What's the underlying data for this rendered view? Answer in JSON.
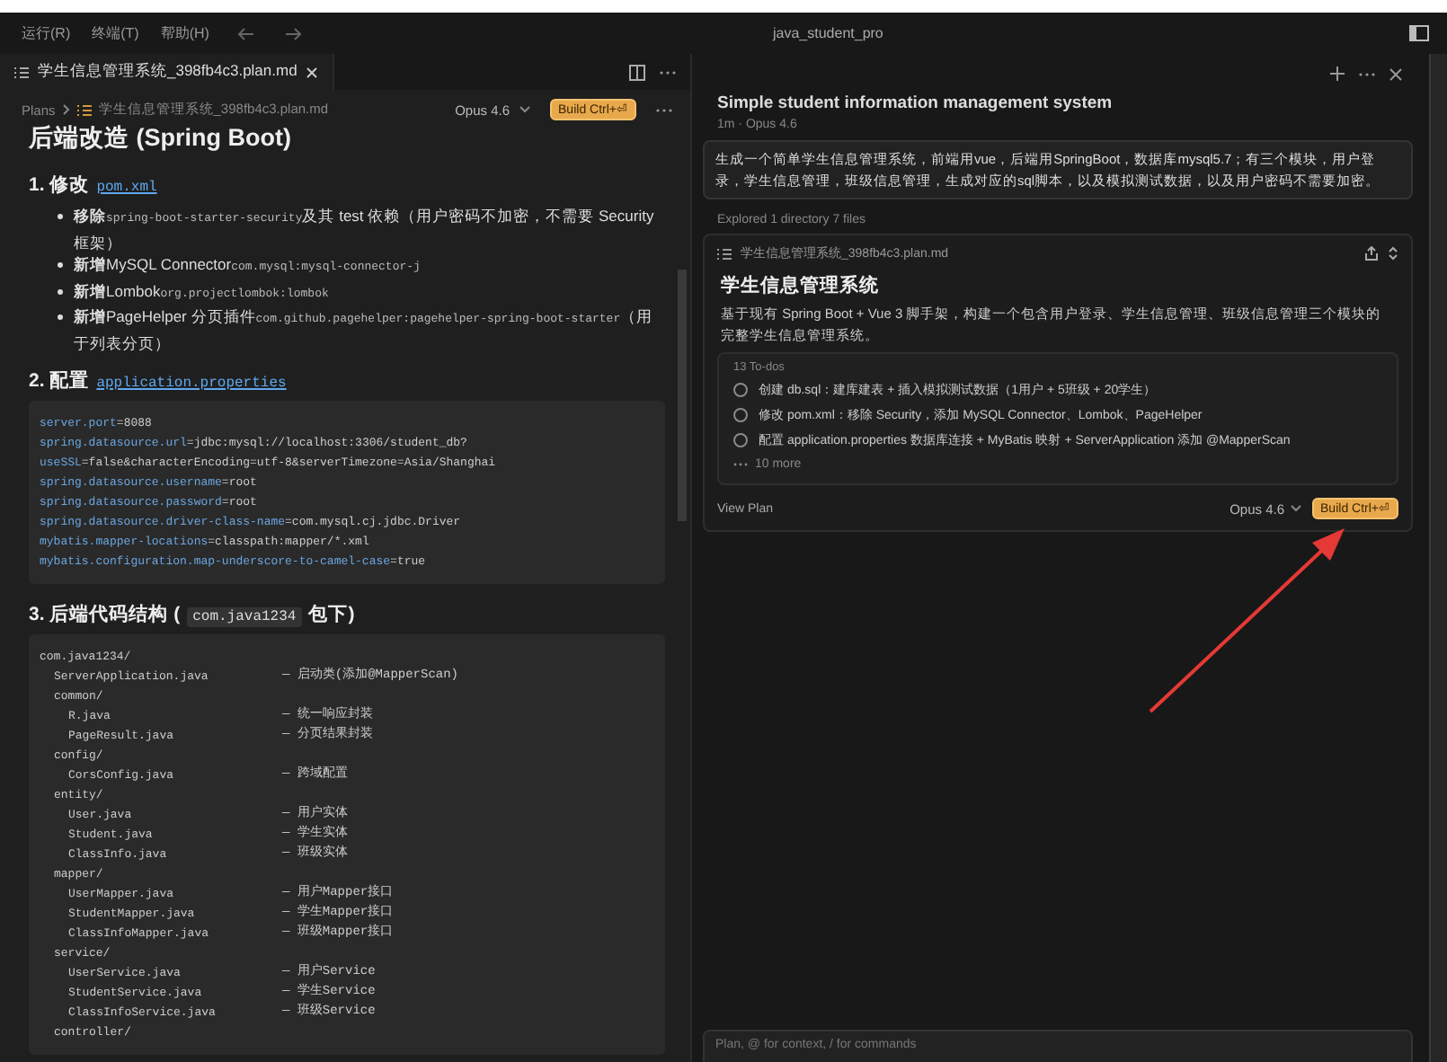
{
  "menu": [
    "运行(R)",
    "终端(T)",
    "帮助(H)"
  ],
  "window": {
    "title": "java_student_pro"
  },
  "editor_tab": {
    "label": "学生信息管理系统_398fb4c3.plan.md",
    "selected": true
  },
  "breadcrumbs": [
    "Plans",
    "学生信息管理系统_398fb4c3.plan.md"
  ],
  "model": "Opus 4.6",
  "build_button": "Build Ctrl+⏎",
  "document": {
    "heading": "后端改造 (Spring Boot)",
    "sections": [
      {
        "title": "1. 修改",
        "code": "pom.xml",
        "kind": "bullets",
        "bullets": [
          [
            {
              "kind": "bold",
              "text": "移除"
            },
            {
              "kind": "code",
              "text": "spring-boot-starter-security"
            },
            {
              "kind": "text",
              "text": "及其 test 依赖（用户密码不加密，不需要 Security 框架）"
            }
          ],
          [
            {
              "kind": "bold",
              "text": "新增"
            },
            {
              "kind": "text",
              "text": "MySQL Connector"
            },
            {
              "kind": "code",
              "text": "com.mysql:mysql-connector-j"
            }
          ],
          [
            {
              "kind": "bold",
              "text": "新增"
            },
            {
              "kind": "text",
              "text": "Lombok"
            },
            {
              "kind": "code",
              "text": "org.projectlombok:lombok"
            }
          ],
          [
            {
              "kind": "bold",
              "text": "新增"
            },
            {
              "kind": "text",
              "text": "PageHelper 分页插件"
            },
            {
              "kind": "code",
              "text": "com.github.pagehelper:pagehelper-spring-boot-starter"
            },
            {
              "kind": "text",
              "text": "（用于列表分页）"
            }
          ]
        ]
      },
      {
        "title": "2. 配置",
        "code": "application.properties",
        "kind": "properties",
        "lines": [
          "server.port=8088",
          "spring.datasource.url=jdbc:mysql://localhost:3306/student_db?",
          "useSSL=false&characterEncoding=utf-8&serverTimezone=Asia/Shanghai",
          "spring.datasource.username=root",
          "spring.datasource.password=root",
          "spring.datasource.driver-class-name=com.mysql.cj.jdbc.Driver",
          "mybatis.mapper-locations=classpath:mapper/*.xml",
          "mybatis.configuration.map-underscore-to-camel-case=true"
        ]
      },
      {
        "title": "3. 后端代码结构 (",
        "code": "com.java1234",
        "suffix": "包下)",
        "kind": "tree",
        "tree": [
          {
            "name": "com.java1234/",
            "children": [
              {
                "name": "ServerApplication.java",
                "note": "— 启动类(添加@MapperScan)"
              },
              {
                "name": "common/",
                "children": [
                  {
                    "name": "R.java",
                    "note": "— 统一响应封装"
                  },
                  {
                    "name": "PageResult.java",
                    "note": "— 分页结果封装"
                  }
                ]
              },
              {
                "name": "config/",
                "children": [
                  {
                    "name": "CorsConfig.java",
                    "note": "— 跨域配置"
                  }
                ]
              },
              {
                "name": "entity/",
                "children": [
                  {
                    "name": "User.java",
                    "note": "— 用户实体"
                  },
                  {
                    "name": "Student.java",
                    "note": "— 学生实体"
                  },
                  {
                    "name": "ClassInfo.java",
                    "note": "— 班级实体"
                  }
                ]
              },
              {
                "name": "mapper/",
                "children": [
                  {
                    "name": "UserMapper.java",
                    "note": "— 用户Mapper接口"
                  },
                  {
                    "name": "StudentMapper.java",
                    "note": "— 学生Mapper接口"
                  },
                  {
                    "name": "ClassInfoMapper.java",
                    "note": "— 班级Mapper接口"
                  }
                ]
              },
              {
                "name": "service/",
                "children": [
                  {
                    "name": "UserService.java",
                    "note": "— 用户Service"
                  },
                  {
                    "name": "StudentService.java",
                    "note": "— 学生Service"
                  },
                  {
                    "name": "ClassInfoService.java",
                    "note": "— 班级Service"
                  }
                ]
              },
              {
                "name": "controller/"
              }
            ]
          }
        ]
      }
    ]
  },
  "chat": {
    "title": "Simple student information management system",
    "meta": "1m · Opus 4.6",
    "prompt": "生成一个简单学生信息管理系统，前端用vue，后端用SpringBoot，数据库mysql5.7；有三个模块，用户登录，学生信息管理，班级信息管理，生成对应的sql脚本，以及模拟测试数据，以及用户密码不需要加密。",
    "explored": "Explored 1 directory 7 files",
    "plan": {
      "file": "学生信息管理系统_398fb4c3.plan.md",
      "title": "学生信息管理系统",
      "description": "基于现有 Spring Boot + Vue 3 脚手架，构建一个包含用户登录、学生信息管理、班级信息管理三个模块的完整学生信息管理系统。",
      "todos_label": "13 To-dos",
      "todos": [
        {
          "text": "创建 db.sql：建库建表 + 插入模拟测试数据（1用户 + 5班级 + 20学生）",
          "checked": false
        },
        {
          "text": "修改 pom.xml：移除 Security，添加 MySQL Connector、Lombok、PageHelper",
          "checked": false
        },
        {
          "text": "配置 application.properties 数据库连接 + MyBatis 映射 + ServerApplication 添加 @MapperScan",
          "checked": false
        }
      ],
      "more": "10 more",
      "view_plan": "View Plan",
      "model": "Opus 4.6",
      "build_button": "Build Ctrl+⏎"
    },
    "input_placeholder": "Plan, @ for context, / for commands"
  }
}
